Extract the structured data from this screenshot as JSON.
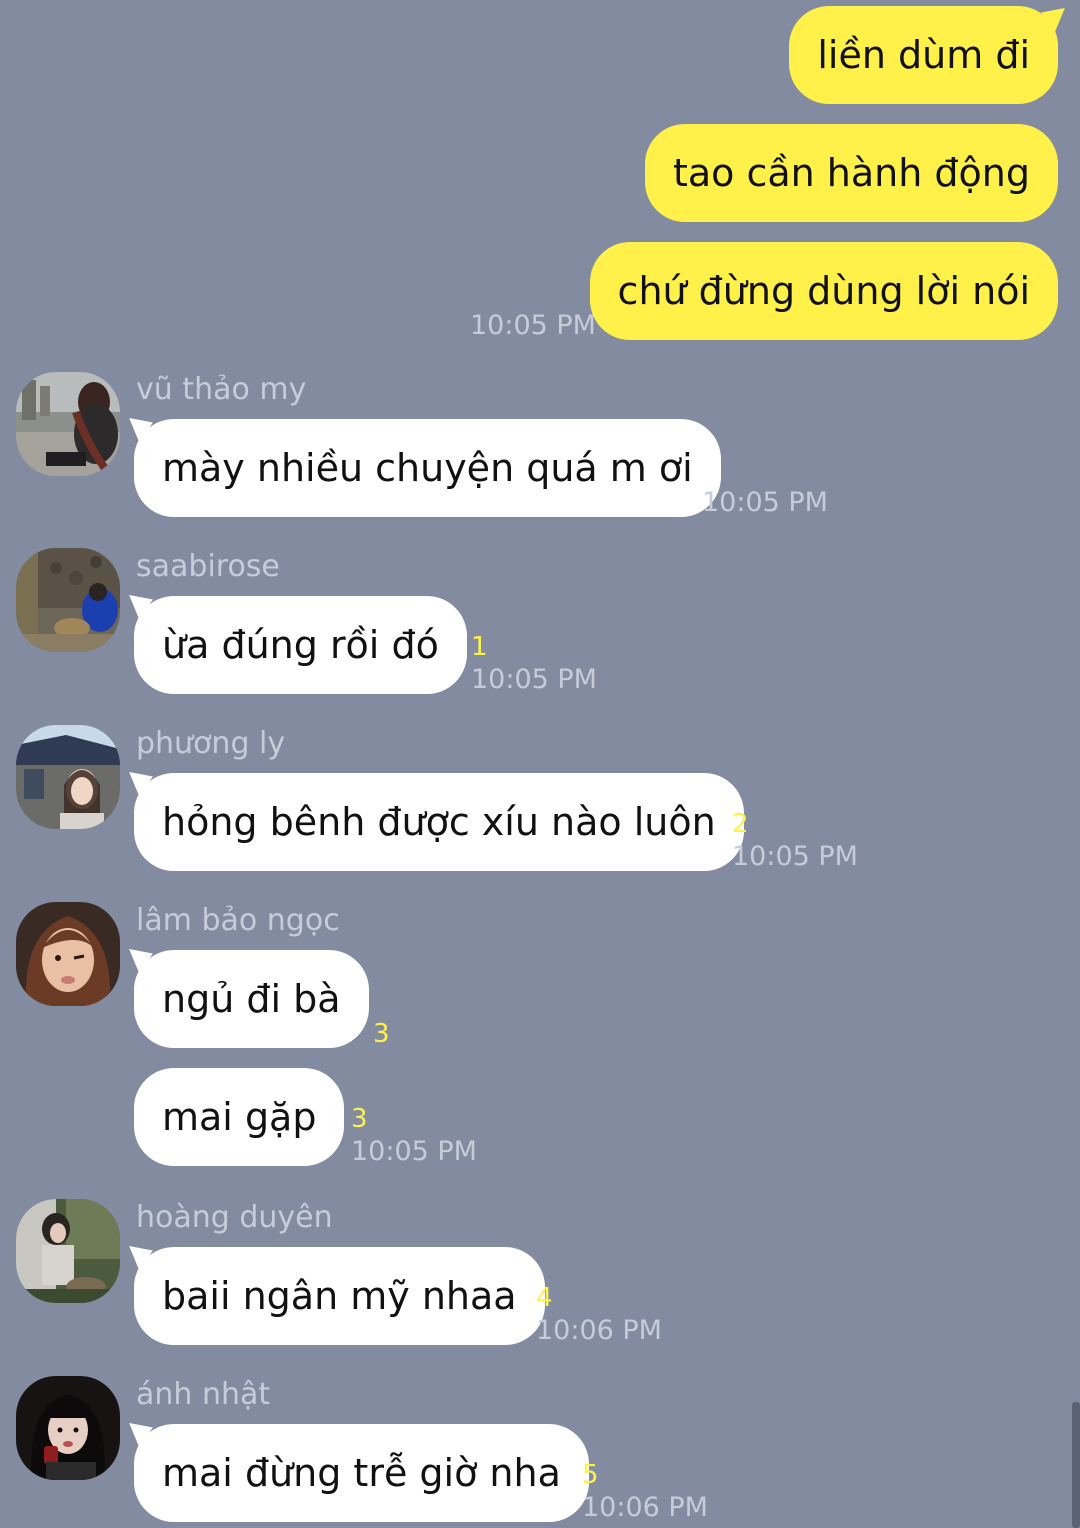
{
  "colors": {
    "background": "#828ba0",
    "outgoing_bubble": "#fff14a",
    "incoming_bubble": "#ffffff",
    "timestamp": "#c6ccd8",
    "unread_count": "#fff14a"
  },
  "outgoing": [
    {
      "text": "liền dùm đi"
    },
    {
      "text": "tao cần hành động"
    },
    {
      "text": "chứ đừng dùng lời nói",
      "time": "10:05 PM"
    }
  ],
  "incoming": [
    {
      "sender": "vũ thảo my",
      "avatar": "avatar-photo-vu-thao-my",
      "text": "mày nhiều chuyện quá m ơi",
      "time": "10:05 PM"
    },
    {
      "sender": "saabirose",
      "avatar": "avatar-photo-saabirose",
      "text": "ừa đúng rồi đó",
      "unread": "1",
      "time": "10:05 PM"
    },
    {
      "sender": "phương ly",
      "avatar": "avatar-photo-phuong-ly",
      "text": "hỏng bênh được xíu nào luôn",
      "unread": "2",
      "time": "10:05 PM"
    },
    {
      "sender": "lâm bảo ngọc",
      "avatar": "avatar-photo-lam-bao-ngoc",
      "text": "ngủ đi bà",
      "unread": "3"
    },
    {
      "text": "mai gặp",
      "unread": "3",
      "time": "10:05 PM"
    },
    {
      "sender": "hoàng duyên",
      "avatar": "avatar-photo-hoang-duyen",
      "text": "baii ngân mỹ nhaa",
      "unread": "4",
      "time": "10:06 PM"
    },
    {
      "sender": "ánh nhật",
      "avatar": "avatar-photo-anh-nhat",
      "text": "mai đừng trễ giờ nha",
      "unread": "5",
      "time": "10:06 PM"
    }
  ]
}
